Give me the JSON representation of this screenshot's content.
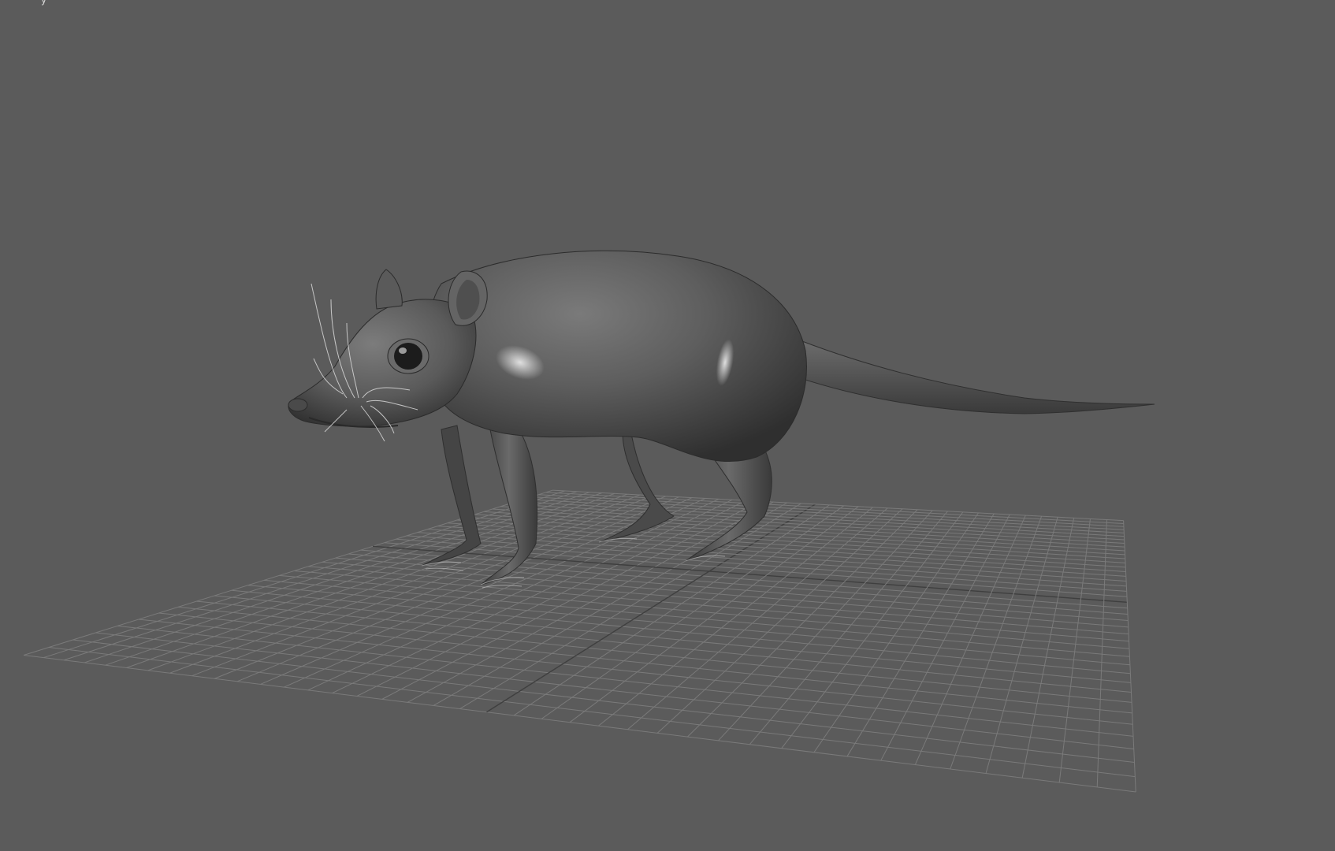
{
  "viewport": {
    "background": "#5b5b5b",
    "grid_color": "#7a7a7a",
    "grid_axis_color": "#3f3f3f",
    "model_base_color": "#5e5e5e",
    "model_highlight_color": "#d6d6d6",
    "model_shadow_color": "#2a2a2a",
    "subject": "rat-model",
    "corner_label": "y",
    "shading_mode": "smooth-shaded",
    "grid_visible": true
  }
}
